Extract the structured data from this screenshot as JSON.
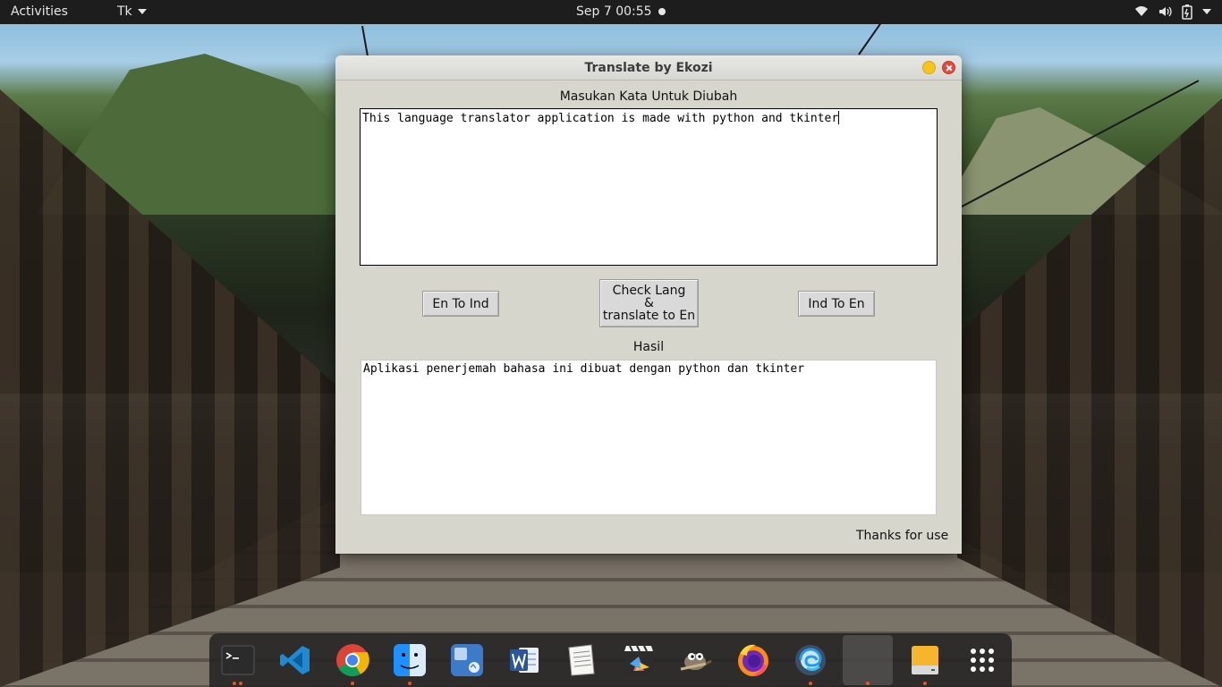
{
  "topbar": {
    "activities": "Activities",
    "app_name": "Tk",
    "clock": "Sep 7  00:55"
  },
  "window": {
    "title": "Translate by Ekozi",
    "input_label": "Masukan Kata Untuk Diubah",
    "input_text": "This language translator application is made with python and tkinter",
    "buttons": {
      "en_to_ind": "En To Ind",
      "check_lang_line1": "Check Lang",
      "check_lang_line2": "&",
      "check_lang_line3": "translate to En",
      "ind_to_en": "Ind To En"
    },
    "output_label": "Hasil",
    "output_text": "Aplikasi penerjemah bahasa ini dibuat dengan python dan tkinter",
    "footer": "Thanks for use"
  },
  "dock": {
    "items": [
      "terminal-icon",
      "vscode-icon",
      "chrome-icon",
      "finder-icon",
      "app-store-icon",
      "word-icon",
      "text-editor-icon",
      "final-cut-icon",
      "gimp-icon",
      "firefox-icon",
      "edge-icon",
      "tk-window-icon",
      "files-drive-icon",
      "app-grid-icon"
    ]
  },
  "colors": {
    "window_bg": "#d6d6cc",
    "topbar_bg": "#1d1d1d",
    "close_button": "#e9473a",
    "minimize_button": "#f5c518",
    "running_indicator": "#e95420"
  }
}
